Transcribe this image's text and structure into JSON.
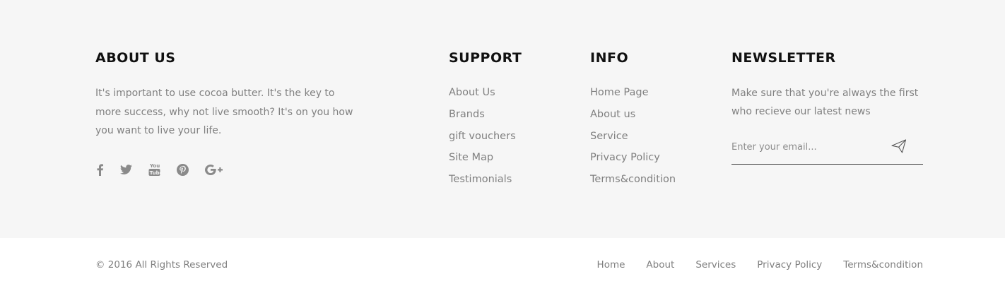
{
  "about": {
    "heading": "ABOUT US",
    "text": "It's important to use cocoa butter. It's the key to more success, why not live smooth? It's on you how you want to live your life.",
    "social": [
      "facebook-icon",
      "twitter-icon",
      "youtube-icon",
      "pinterest-icon",
      "google-plus-icon"
    ]
  },
  "support": {
    "heading": "SUPPORT",
    "links": [
      "About Us",
      "Brands",
      "gift vouchers",
      "Site Map",
      "Testimonials"
    ]
  },
  "info": {
    "heading": "INFO",
    "links": [
      "Home Page",
      "About us",
      "Service",
      "Privacy Policy",
      "Terms&condition"
    ]
  },
  "newsletter": {
    "heading": "NEWSLETTER",
    "text": "Make sure that you're always the first who recieve our latest news",
    "placeholder": "Enter your email...",
    "value": "",
    "send_icon": "paper-plane-icon"
  },
  "bottom": {
    "copyright": "© 2016 All Rights Reserved",
    "nav": [
      "Home",
      "About",
      "Services",
      "Privacy Policy",
      "Terms&condition"
    ]
  },
  "colors": {
    "top_background": "#f6f6f6",
    "bottom_background": "#ffffff",
    "heading": "#111111",
    "text": "#808080"
  }
}
